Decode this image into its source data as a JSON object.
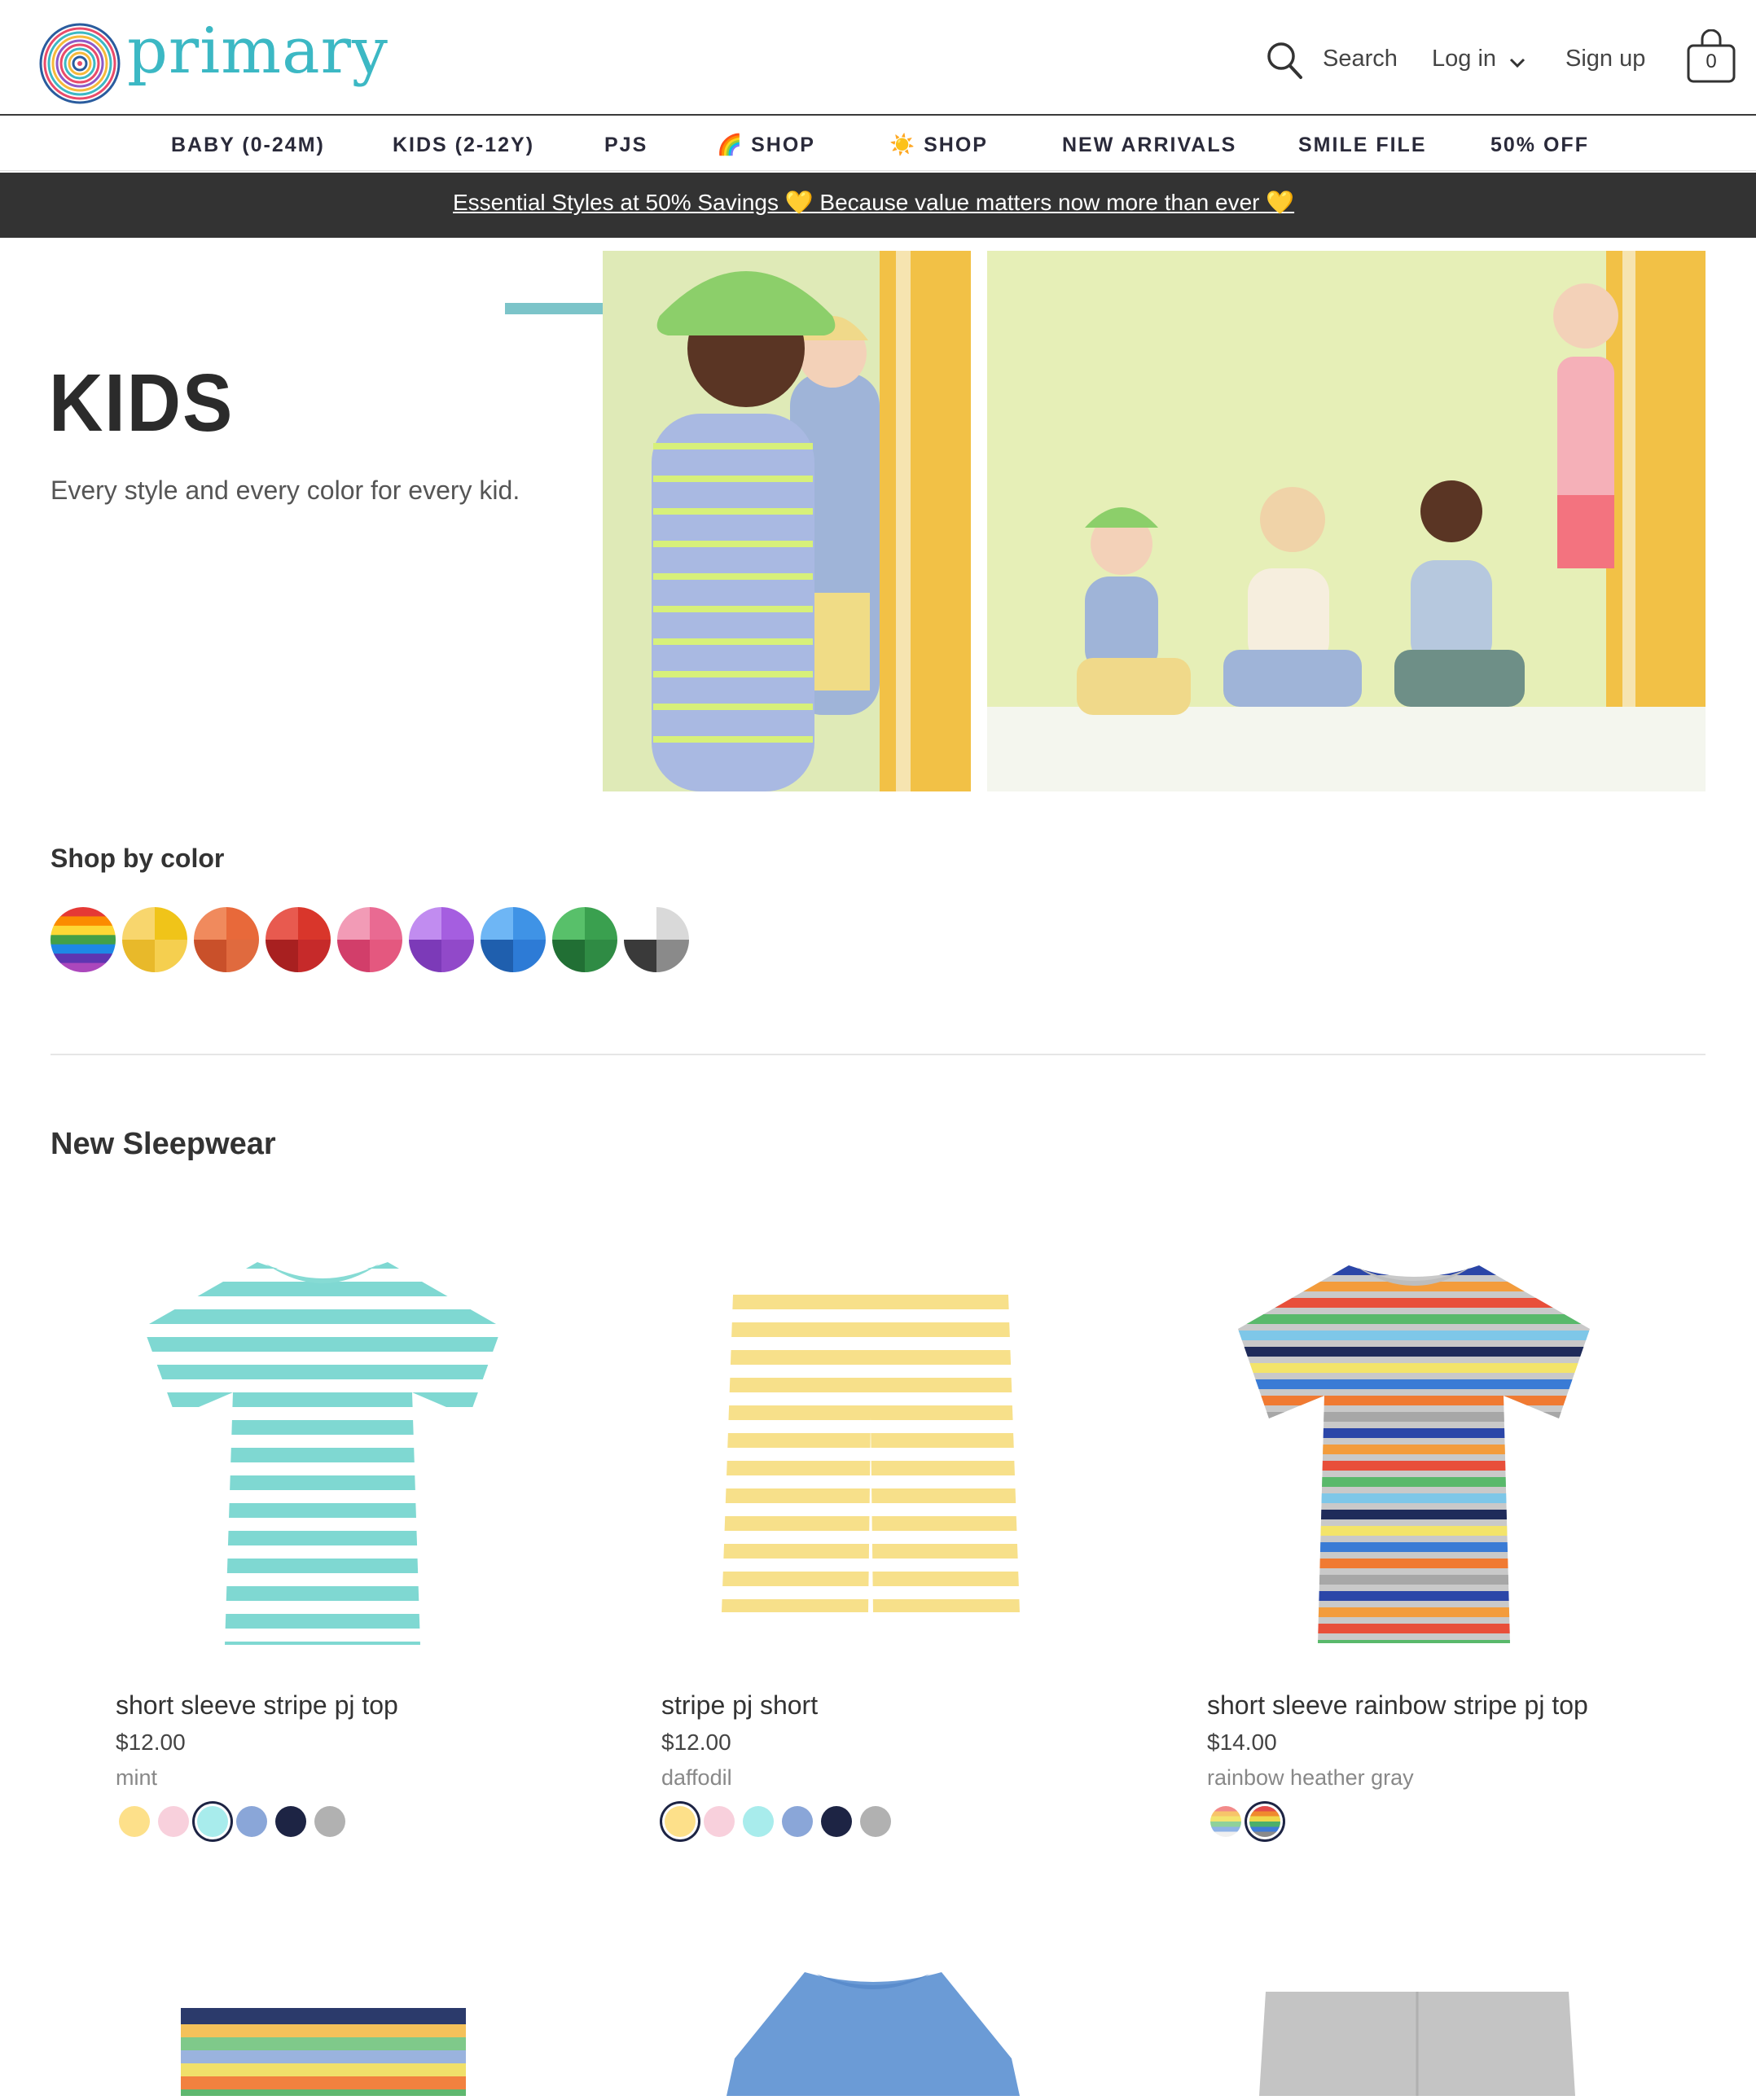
{
  "brand": {
    "name": "primary"
  },
  "header": {
    "search_label": "Search",
    "login_label": "Log in",
    "signup_label": "Sign up",
    "cart_count": "0"
  },
  "nav": {
    "items": [
      {
        "label": "BABY (0-24M)"
      },
      {
        "label": "KIDS (2-12Y)"
      },
      {
        "label": "PJS"
      },
      {
        "label": "SHOP",
        "emoji": "🌈"
      },
      {
        "label": "SHOP",
        "emoji": "☀️"
      },
      {
        "label": "NEW ARRIVALS"
      },
      {
        "label": "SMILE FILE"
      },
      {
        "label": "50% OFF"
      }
    ]
  },
  "promo": {
    "text": "Essential Styles at 50% Savings 💛 Because value matters now more than ever 💛"
  },
  "hero": {
    "title": "KIDS",
    "subtitle": "Every style and every color for every kid."
  },
  "shop_by_color": {
    "label": "Shop by color",
    "swatches": [
      {
        "name": "rainbow",
        "colors": [
          "#e53935",
          "#fb8c00",
          "#fdd835",
          "#43a047",
          "#1e88e5",
          "#5e35b1",
          "#ab47bc"
        ]
      },
      {
        "name": "yellow",
        "colors": [
          "#f8d66d",
          "#f0c419",
          "#e8b92a",
          "#f5cf4f"
        ]
      },
      {
        "name": "orange",
        "colors": [
          "#f08a5d",
          "#e8693a",
          "#c9502a",
          "#e06a3e"
        ]
      },
      {
        "name": "red",
        "colors": [
          "#e85a4f",
          "#d9362b",
          "#a82020",
          "#c62a2a"
        ]
      },
      {
        "name": "pink",
        "colors": [
          "#f29bb6",
          "#e96a92",
          "#d23e6a",
          "#e4587f"
        ]
      },
      {
        "name": "purple",
        "colors": [
          "#c18cf0",
          "#a55ee0",
          "#7c3ab8",
          "#9149c9"
        ]
      },
      {
        "name": "blue",
        "colors": [
          "#6eb6f5",
          "#3f93e6",
          "#1f5fae",
          "#2d7bd6"
        ]
      },
      {
        "name": "green",
        "colors": [
          "#58c06a",
          "#3aa04f",
          "#216f34",
          "#2f8b44"
        ]
      },
      {
        "name": "gray",
        "colors": [
          "#ffffff",
          "#d9d9d9",
          "#3a3a3a",
          "#8a8a8a"
        ]
      }
    ]
  },
  "section": {
    "title": "New Sleepwear"
  },
  "products": [
    {
      "name": "short sleeve stripe pj top",
      "price": "$12.00",
      "color": "mint",
      "image": "mint-stripe-tee",
      "swatches": [
        "#fde08a",
        "#f8d0dc",
        "#a8ecec",
        "#8aa6d8",
        "#1d2444",
        "#b1b1b1"
      ],
      "selected": 2
    },
    {
      "name": "stripe pj short",
      "price": "$12.00",
      "color": "daffodil",
      "image": "yellow-stripe-shorts",
      "swatches": [
        "#fde08a",
        "#f8d0dc",
        "#a8ecec",
        "#8aa6d8",
        "#1d2444",
        "#b1b1b1"
      ],
      "selected": 0
    },
    {
      "name": "short sleeve rainbow stripe pj top",
      "price": "$14.00",
      "color": "rainbow heather gray",
      "image": "rainbow-stripe-tee",
      "swatches": [
        "rainbow-light",
        "rainbow-dark"
      ],
      "selected": 1
    }
  ],
  "colors": {
    "brand_teal": "#3cb8c4",
    "promo_bg": "#333333",
    "selected_ring": "#1d2444"
  }
}
